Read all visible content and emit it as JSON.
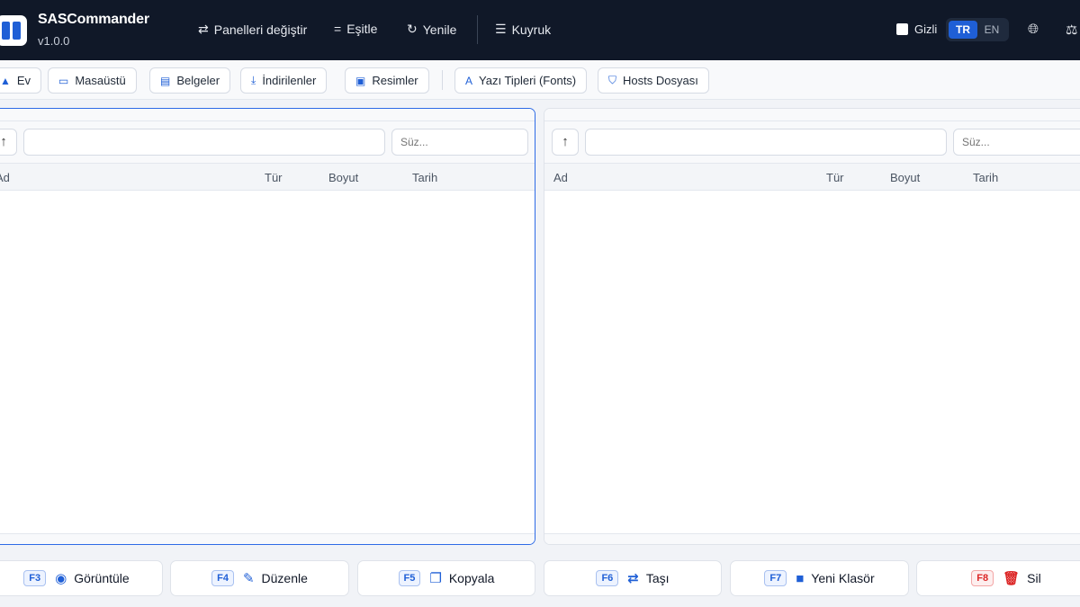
{
  "app": {
    "title": "SASCommander",
    "version": "v1.0.0"
  },
  "topnav": [
    {
      "label": "Panelleri değiştir",
      "icon": "swap-icon"
    },
    {
      "label": "Eşitle",
      "icon": "equals-icon"
    },
    {
      "label": "Yenile",
      "icon": "refresh-icon"
    },
    {
      "label": "Kuyruk",
      "icon": "queue-icon"
    }
  ],
  "hidden_label": "Gizli",
  "lang": {
    "tr": "TR",
    "en": "EN",
    "selected": "TR"
  },
  "bookmarks": [
    {
      "label": "Ev",
      "icon": "home-icon"
    },
    {
      "label": "Masaüstü",
      "icon": "desktop-icon"
    },
    {
      "label": "Belgeler",
      "icon": "document-icon"
    },
    {
      "label": "İndirilenler",
      "icon": "download-icon"
    },
    {
      "label": "Resimler",
      "icon": "image-icon"
    },
    {
      "label": "Yazı Tipleri (Fonts)",
      "icon": "font-icon"
    },
    {
      "label": "Hosts Dosyası",
      "icon": "shield-icon"
    }
  ],
  "left_panel": {
    "path": "",
    "filter_placeholder": "Süz...",
    "columns": {
      "name": "Ad",
      "type": "Tür",
      "size": "Boyut",
      "date": "Tarih"
    }
  },
  "right_panel": {
    "path": "",
    "filter_placeholder": "Süz...",
    "columns": {
      "name": "Ad",
      "type": "Tür",
      "size": "Boyut",
      "date": "Tarih"
    }
  },
  "function_keys": [
    {
      "key": "F3",
      "label": "Görüntüle",
      "icon": "eye-icon"
    },
    {
      "key": "F4",
      "label": "Düzenle",
      "icon": "edit-icon"
    },
    {
      "key": "F5",
      "label": "Kopyala",
      "icon": "copy-icon"
    },
    {
      "key": "F6",
      "label": "Taşı",
      "icon": "move-icon"
    },
    {
      "key": "F7",
      "label": "Yeni Klasör",
      "icon": "new-folder-icon"
    },
    {
      "key": "F8",
      "label": "Sil",
      "icon": "trash-icon"
    }
  ],
  "colors": {
    "accent": "#1f5fd6",
    "topbar": "#101828",
    "danger": "#dc2626"
  }
}
